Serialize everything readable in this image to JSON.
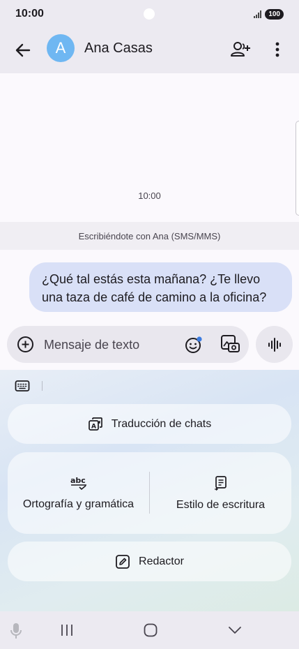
{
  "status_bar": {
    "time": "10:00",
    "battery": "100"
  },
  "header": {
    "avatar_letter": "A",
    "contact_name": "Ana Casas"
  },
  "conversation": {
    "timestamp": "10:00",
    "info_banner": "Escribiéndote con Ana (SMS/MMS)",
    "messages": [
      {
        "text": "¿Qué tal estás esta mañana? ¿Te llevo una taza de café de camino a la oficina?",
        "direction": "outgoing"
      }
    ]
  },
  "compose": {
    "placeholder": "Mensaje de texto"
  },
  "ai_tools": {
    "translate_label": "Traducción de chats",
    "spelling_label": "Ortografía y gramática",
    "style_label": "Estilo de escritura",
    "composer_label": "Redactor"
  },
  "icons": {
    "back": "arrow-left-icon",
    "add_contact": "add-person-icon",
    "more": "more-vert-icon",
    "add": "plus-circle-icon",
    "emoji": "emoji-icon",
    "gallery": "gallery-icon",
    "voice": "waveform-icon",
    "keyboard": "keyboard-icon",
    "translate": "translate-icon",
    "spelling": "spellcheck-icon",
    "style": "writing-style-icon",
    "composer": "edit-icon",
    "mic": "mic-icon",
    "recents": "recents-icon",
    "home": "home-icon",
    "hide_keyboard": "chevron-down-icon"
  },
  "colors": {
    "avatar": "#6fb7f2",
    "bubble": "#d9e0f7",
    "app_bar": "#eceaf1",
    "notification_dot": "#3b7be0"
  }
}
